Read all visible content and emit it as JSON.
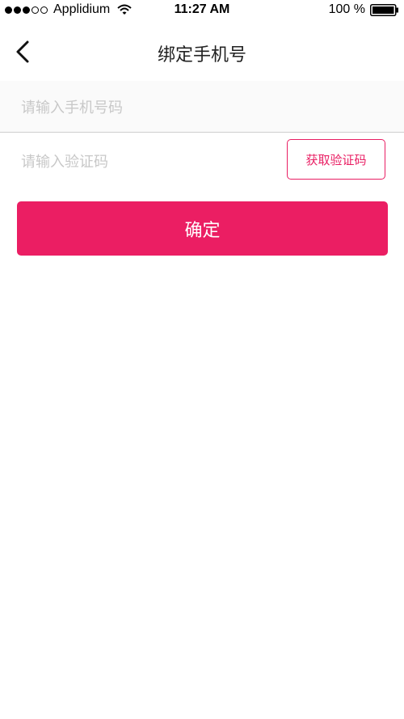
{
  "status_bar": {
    "carrier": "Applidium",
    "time": "11:27 AM",
    "battery_text": "100 %",
    "signal_icon": "signal-dots-icon",
    "wifi_icon": "wifi-icon",
    "battery_icon": "battery-full-icon",
    "signal_filled": 3,
    "signal_total": 5
  },
  "nav": {
    "title": "绑定手机号",
    "back_icon": "chevron-left-icon"
  },
  "form": {
    "phone_placeholder": "请输入手机号码",
    "phone_value": "",
    "code_placeholder": "请输入验证码",
    "code_value": "",
    "get_code_label": "获取验证码",
    "confirm_label": "确定"
  },
  "colors": {
    "accent": "#eb1e63",
    "placeholder": "#c8c8c8"
  }
}
